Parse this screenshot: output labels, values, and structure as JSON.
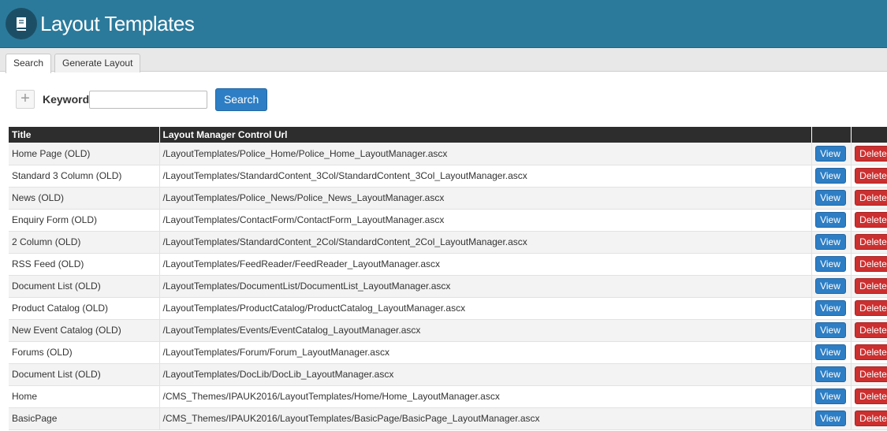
{
  "header": {
    "title": "Layout Templates",
    "icon": "book-icon"
  },
  "tabs": [
    {
      "label": "Search",
      "active": true
    },
    {
      "label": "Generate Layout",
      "active": false
    }
  ],
  "search": {
    "keyword_label": "Keyword",
    "keyword_value": "",
    "button_label": "Search"
  },
  "table": {
    "headers": [
      "Title",
      "Layout Manager Control Url",
      "",
      ""
    ],
    "view_label": "View",
    "delete_label": "Delete",
    "rows": [
      {
        "title": "Home Page (OLD)",
        "url": "/LayoutTemplates/Police_Home/Police_Home_LayoutManager.ascx"
      },
      {
        "title": "Standard 3 Column (OLD)",
        "url": "/LayoutTemplates/StandardContent_3Col/StandardContent_3Col_LayoutManager.ascx"
      },
      {
        "title": "News (OLD)",
        "url": "/LayoutTemplates/Police_News/Police_News_LayoutManager.ascx"
      },
      {
        "title": "Enquiry Form (OLD)",
        "url": "/LayoutTemplates/ContactForm/ContactForm_LayoutManager.ascx"
      },
      {
        "title": "2 Column (OLD)",
        "url": "/LayoutTemplates/StandardContent_2Col/StandardContent_2Col_LayoutManager.ascx"
      },
      {
        "title": "RSS Feed (OLD)",
        "url": "/LayoutTemplates/FeedReader/FeedReader_LayoutManager.ascx"
      },
      {
        "title": "Document List (OLD)",
        "url": "/LayoutTemplates/DocumentList/DocumentList_LayoutManager.ascx"
      },
      {
        "title": "Product Catalog (OLD)",
        "url": "/LayoutTemplates/ProductCatalog/ProductCatalog_LayoutManager.ascx"
      },
      {
        "title": "New Event Catalog (OLD)",
        "url": "/LayoutTemplates/Events/EventCatalog_LayoutManager.ascx"
      },
      {
        "title": "Forums (OLD)",
        "url": "/LayoutTemplates/Forum/Forum_LayoutManager.ascx"
      },
      {
        "title": "Document List (OLD)",
        "url": "/LayoutTemplates/DocLib/DocLib_LayoutManager.ascx"
      },
      {
        "title": "Home",
        "url": "/CMS_Themes/IPAUK2016/LayoutTemplates/Home/Home_LayoutManager.ascx"
      },
      {
        "title": "BasicPage",
        "url": "/CMS_Themes/IPAUK2016/LayoutTemplates/BasicPage/BasicPage_LayoutManager.ascx"
      }
    ]
  },
  "colors": {
    "header_bg": "#2b7a9b",
    "primary": "#2d7ec4",
    "danger": "#cc2f2f",
    "table_header": "#2d2d2d"
  }
}
